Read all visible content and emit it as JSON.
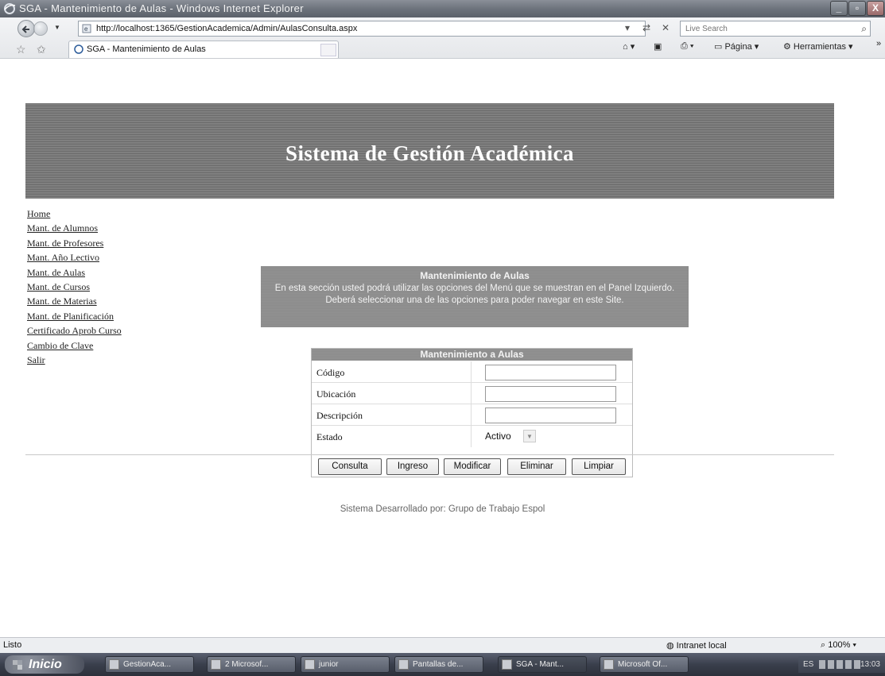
{
  "window": {
    "title": "SGA - Mantenimiento de Aulas - Windows Internet Explorer",
    "minimize_glyph": "_",
    "maximize_glyph": "▫",
    "close_glyph": "X"
  },
  "browser": {
    "url": "http://localhost:1365/GestionAcademica/Admin/AulasConsulta.aspx",
    "search_placeholder": "Live Search",
    "tab_title": "SGA - Mantenimiento de Aulas",
    "commands": {
      "page": "Página",
      "tools": "Herramientas",
      "more": "»"
    }
  },
  "page": {
    "header_title": "Sistema de Gestión Académica",
    "menu": [
      "Home",
      "Mant. de Alumnos",
      "Mant. de Profesores",
      "Mant. Año Lectivo",
      "Mant. de Aulas",
      "Mant. de Cursos",
      "Mant. de Materias",
      "Mant. de Planificación",
      "Certificado Aprob Curso",
      "Cambio de Clave",
      "Salir"
    ],
    "info_box": {
      "title": "Mantenimiento de Aulas",
      "text": "En esta sección usted podrá utilizar las opciones del Menú que se muestran en el Panel Izquierdo. Deberá seleccionar una de las opciones para poder navegar en este Site."
    },
    "form": {
      "title": "Mantenimiento a Aulas",
      "fields": {
        "codigo_label": "Código",
        "ubicacion_label": "Ubicación",
        "descripcion_label": "Descripción",
        "estado_label": "Estado",
        "estado_value": "Activo"
      },
      "buttons": [
        "Consulta",
        "Ingreso",
        "Modificar",
        "Eliminar",
        "Limpiar"
      ]
    },
    "footer": "Sistema Desarrollado por: Grupo de Trabajo Espol"
  },
  "statusbar": {
    "status": "Listo",
    "zone": "Intranet local",
    "zoom": "100%"
  },
  "taskbar": {
    "start": "Inicio",
    "items": [
      "GestionAca...",
      "2 Microsof...",
      "junior",
      "Pantallas de...",
      "SGA - Mant...",
      "Microsoft Of..."
    ],
    "lang": "ES",
    "time": "13:03"
  }
}
